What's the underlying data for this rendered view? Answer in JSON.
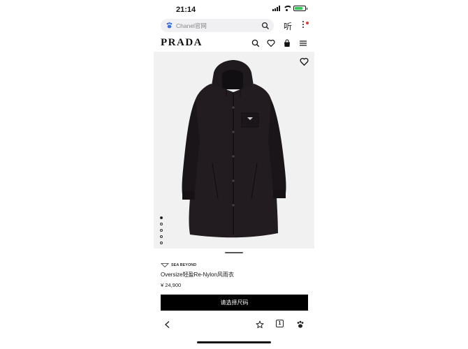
{
  "status_bar": {
    "time": "21:14",
    "battery_percent": 80,
    "battery_color": "#34c759"
  },
  "browser": {
    "url_text": "Chanel官网",
    "listen_label": "听",
    "icons": [
      "paw-icon",
      "search-icon",
      "more-vertical-icon"
    ],
    "notification_dot_color": "#e53935"
  },
  "site_header": {
    "logo": "PRADA",
    "icons": [
      "search-icon",
      "heart-icon",
      "bag-icon",
      "menu-icon"
    ]
  },
  "product": {
    "image_alt_icon": "coat-image",
    "gallery_total": 5,
    "gallery_active": 1,
    "collab_label": "SEA BEYOND",
    "name": "Oversize轻盈Re-Nylon风雨衣",
    "price": "¥ 24,900",
    "select_size_label": "请选择尺码",
    "background_color": "#f1f1f1"
  },
  "bottom_nav": {
    "tab_count": "1",
    "icons": [
      "back-chevron-icon",
      "star-icon",
      "tabs-icon",
      "paw-icon"
    ]
  }
}
